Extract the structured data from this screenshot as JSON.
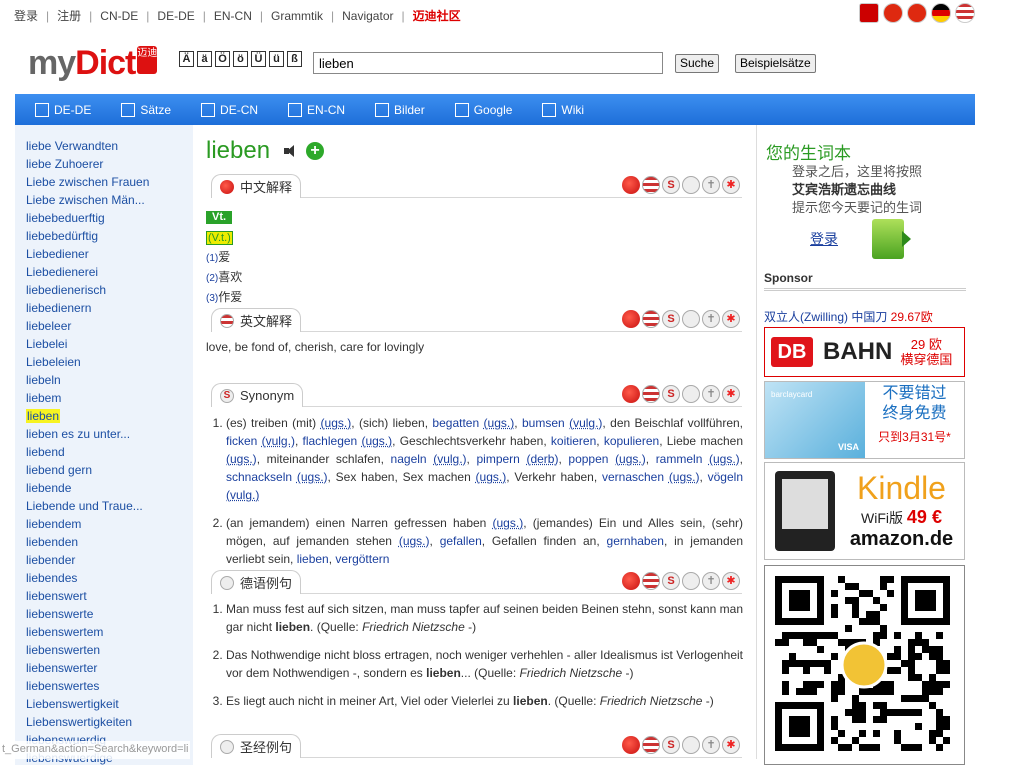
{
  "topnav": {
    "items": [
      "登录",
      "注册",
      "CN-DE",
      "DE-DE",
      "EN-CN",
      "Grammtik",
      "Navigator",
      "迈迪社区"
    ]
  },
  "flags": [
    "youtube-icon",
    "china-flag-icon",
    "hongkong-flag-icon",
    "germany-flag-icon",
    "usa-flag-icon"
  ],
  "logo": {
    "my": "my",
    "dict": "Dict",
    "seal": "迈迪"
  },
  "umlauts": [
    "Ä",
    "ä",
    "Ö",
    "ö",
    "Ü",
    "ü",
    "ß"
  ],
  "search": {
    "value": "lieben",
    "button": "Suche",
    "examples_button": "Beispielsätze"
  },
  "nav": [
    {
      "label": "DE-DE",
      "icon": "de-de-icon"
    },
    {
      "label": "Sätze",
      "icon": "saetze-icon"
    },
    {
      "label": "DE-CN",
      "icon": "de-cn-icon"
    },
    {
      "label": "EN-CN",
      "icon": "en-cn-icon"
    },
    {
      "label": "Bilder",
      "icon": "bilder-icon"
    },
    {
      "label": "Google",
      "icon": "google-icon"
    },
    {
      "label": "Wiki",
      "icon": "wiki-icon"
    }
  ],
  "sidebar": {
    "items": [
      "liebe Verwandten",
      "liebe Zuhoerer",
      "Liebe zwischen Frauen",
      "Liebe zwischen Män...",
      "liebebeduerftig",
      "liebebedürftig",
      "Liebediener",
      "Liebedienerei",
      "liebedienerisch",
      "liebedienern",
      "liebeleer",
      "Liebelei",
      "Liebeleien",
      "liebeln",
      "liebem",
      "lieben",
      "lieben es zu unter...",
      "liebend",
      "liebend gern",
      "liebende",
      "Liebende und Traue...",
      "liebendem",
      "liebenden",
      "liebender",
      "liebendes",
      "liebenswert",
      "liebenswerte",
      "liebenswertem",
      "liebenswerten",
      "liebenswerter",
      "liebenswertes",
      "Liebenswertigkeit",
      "Liebenswertigkeiten",
      "liebenswuerdig",
      "liebenswuerdige"
    ],
    "highlighted": "lieben"
  },
  "headword": "lieben",
  "sections": {
    "chinese": {
      "title": "中文解释",
      "pos": "Vt.",
      "pos2": "(V.t.)",
      "meanings": [
        {
          "num": "(1)",
          "text": "爱"
        },
        {
          "num": "(2)",
          "text": "喜欢"
        },
        {
          "num": "(3)",
          "text": "作爱"
        }
      ]
    },
    "english": {
      "title": "英文解释",
      "text": "love, be fond of, cherish, care for lovingly"
    },
    "synonym": {
      "title": "Synonym",
      "entry1": [
        "(es) treiben (mit) ",
        {
          "l": "(ugs.)"
        },
        ", (sich) lieben, ",
        {
          "k": "begatten"
        },
        " ",
        {
          "l": "(ugs.)"
        },
        ", ",
        {
          "k": "bumsen"
        },
        " ",
        {
          "l": "(vulg.)"
        },
        ", den Beischlaf vollführen, ",
        {
          "k": "ficken"
        },
        " ",
        {
          "l": "(vulg.)"
        },
        ", ",
        {
          "k": "flachlegen"
        },
        " ",
        {
          "l": "(ugs.)"
        },
        ", Geschlechtsverkehr haben, ",
        {
          "k": "koitieren"
        },
        ", ",
        {
          "k": "kopulieren"
        },
        ", Liebe machen ",
        {
          "l": "(ugs.)"
        },
        ", miteinander schlafen, ",
        {
          "k": "nageln"
        },
        " ",
        {
          "l": "(vulg.)"
        },
        ", ",
        {
          "k": "pimpern"
        },
        " ",
        {
          "l": "(derb)"
        },
        ", ",
        {
          "k": "poppen"
        },
        " ",
        {
          "l": "(ugs.)"
        },
        ", ",
        {
          "k": "rammeln"
        },
        " ",
        {
          "l": "(ugs.)"
        },
        ", ",
        {
          "k": "schnackseln"
        },
        " ",
        {
          "l": "(ugs.)"
        },
        ", Sex haben, Sex machen ",
        {
          "l": "(ugs.)"
        },
        ", Verkehr haben, ",
        {
          "k": "vernaschen"
        },
        " ",
        {
          "l": "(ugs.)"
        },
        ", ",
        {
          "k": "vögeln"
        },
        " ",
        {
          "l": "(vulg.)"
        }
      ],
      "entry2": [
        "(an jemandem) einen Narren gefressen haben ",
        {
          "l": "(ugs.)"
        },
        ", (jemandes) Ein und Alles sein, (sehr) mögen, auf jemanden stehen ",
        {
          "l": "(ugs.)"
        },
        ", ",
        {
          "k": "gefallen"
        },
        ", Gefallen finden an, ",
        {
          "k": "gernhaben"
        },
        ", in jemanden verliebt sein, ",
        {
          "k": "lieben"
        },
        ", ",
        {
          "k": "vergöttern"
        }
      ]
    },
    "examples": {
      "title": "德语例句",
      "items": [
        {
          "pre": "Man muss fest auf sich sitzen, man muss tapfer auf seinen beiden Beinen stehn, sonst kann man gar nicht ",
          "bold": "lieben",
          "post": ". (Quelle: ",
          "source": "Friedrich Nietzsche",
          "end": " -)"
        },
        {
          "pre": "Das Nothwendige nicht bloss ertragen, noch weniger verhehlen - aller Idealismus ist Verlogenheit vor dem Nothwendigen -, sondern es ",
          "bold": "lieben",
          "post": "... (Quelle: ",
          "source": "Friedrich Nietzsche",
          "end": " -)"
        },
        {
          "pre": "Es liegt auch nicht in meiner Art, Viel oder Vielerlei zu ",
          "bold": "lieben",
          "post": ". (Quelle: ",
          "source": "Friedrich Nietzsche",
          "end": " -)"
        }
      ]
    },
    "bible": {
      "title": "圣经例句"
    }
  },
  "right": {
    "vocab_title": "您的生词本",
    "vocab_line1": "登录之后，这里将按照",
    "vocab_line2": "艾宾浩斯遗忘曲线",
    "vocab_line3": "提示您今天要记的生词",
    "login": "登录",
    "sponsor": "Sponsor",
    "ad_text": "双立人(Zwilling) 中国刀 ",
    "ad_price": "29.67欧",
    "db_logo": "DB",
    "db_bahn": "BAHN",
    "db_line1": "29 欧",
    "db_line2": "横穿德国",
    "card_brand": "barclaycard",
    "card_visa": "VISA",
    "card_line1": "不要错过",
    "card_line2": "终身免费",
    "card_line3": "只到3月31号*",
    "kindle": "Kindle",
    "kindle_wifi": "WiFi版 ",
    "kindle_price": "49 €",
    "kindle_amazon": "amazon.de"
  },
  "status_text": "t_German&action=Search&keyword=li"
}
